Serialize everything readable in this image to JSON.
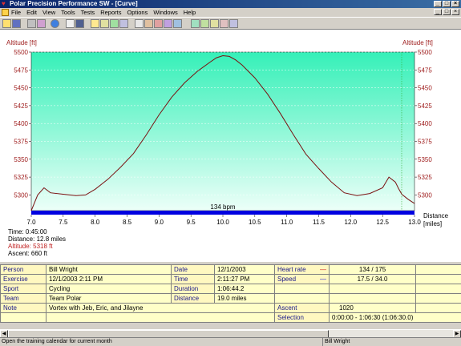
{
  "window": {
    "title": "Polar Precision Performance SW - [Curve]"
  },
  "menu": [
    "File",
    "Edit",
    "View",
    "Tools",
    "Tests",
    "Reports",
    "Options",
    "Windows",
    "Help"
  ],
  "chart_data": {
    "type": "line",
    "ylabel_left": "Altitude [ft]",
    "ylabel_right": "Altitude [ft]",
    "xlabel": "Distance [miles]",
    "xlim": [
      7.0,
      13.0
    ],
    "ylim": [
      5250,
      5500
    ],
    "xticks": [
      "7.0",
      "7.5",
      "8.0",
      "8.5",
      "9.0",
      "9.5",
      "10.0",
      "10.5",
      "11.0",
      "11.5",
      "12.0",
      "12.5",
      "13.0"
    ],
    "yticks": [
      "5275",
      "5300",
      "5325",
      "5350",
      "5375",
      "5400",
      "5425",
      "5450",
      "5475",
      "5500"
    ],
    "hr_band_label": "134 bpm",
    "series": [
      {
        "x": [
          7.0,
          7.1,
          7.2,
          7.3,
          7.5,
          7.7,
          7.85,
          8.0,
          8.2,
          8.4,
          8.6,
          8.8,
          9.0,
          9.2,
          9.4,
          9.6,
          9.8,
          9.9,
          10.0,
          10.1,
          10.2,
          10.3,
          10.5,
          10.7,
          10.9,
          11.1,
          11.3,
          11.5,
          11.7,
          11.9,
          12.1,
          12.3,
          12.5,
          12.6,
          12.7,
          12.75,
          12.8,
          12.9,
          13.0
        ],
        "y": [
          5278,
          5300,
          5310,
          5303,
          5301,
          5299,
          5300,
          5308,
          5322,
          5339,
          5358,
          5384,
          5412,
          5437,
          5457,
          5473,
          5486,
          5492,
          5495,
          5494,
          5489,
          5482,
          5464,
          5441,
          5414,
          5385,
          5357,
          5337,
          5318,
          5303,
          5299,
          5302,
          5310,
          5325,
          5318,
          5309,
          5301,
          5294,
          5288
        ]
      }
    ]
  },
  "info": {
    "time": "Time: 0:45:00",
    "distance": "Distance: 12.8 miles",
    "altitude": "Altitude: 5318 ft",
    "ascent": "Ascent: 660 ft"
  },
  "colors": {
    "plot_fill_top": "#35f0b8",
    "plot_fill_bottom": "#ecfff8",
    "line": "#7a1010",
    "axis_label": "#a02020",
    "hr_band": "#0000e0"
  },
  "table": {
    "person_label": "Person",
    "person": "Bill Wright",
    "date_label": "Date",
    "date": "12/1/2003",
    "hr_label": "Heart rate",
    "hr": "134 / 175",
    "exercise_label": "Exercise",
    "exercise": "12/1/2003 2:11 PM",
    "time_label": "Time",
    "time": "2:11:27 PM",
    "speed_label": "Speed",
    "speed": "17.5 / 34.0",
    "sport_label": "Sport",
    "sport": "Cycling",
    "duration_label": "Duration",
    "duration": "1:06:44.2",
    "team_label": "Team",
    "team": "Team Polar",
    "distance_label": "Distance",
    "distance": "19.0 miles",
    "note_label": "Note",
    "note": "Vortex with Jeb, Eric, and Jilayne",
    "ascent_label": "Ascent",
    "ascent": "1020",
    "selection_label": "Selection",
    "selection": "0:00:00 - 1:06:30 (1:06:30.0)"
  },
  "status": {
    "left": "Open the training calendar for current month",
    "right": "Bill Wright"
  }
}
